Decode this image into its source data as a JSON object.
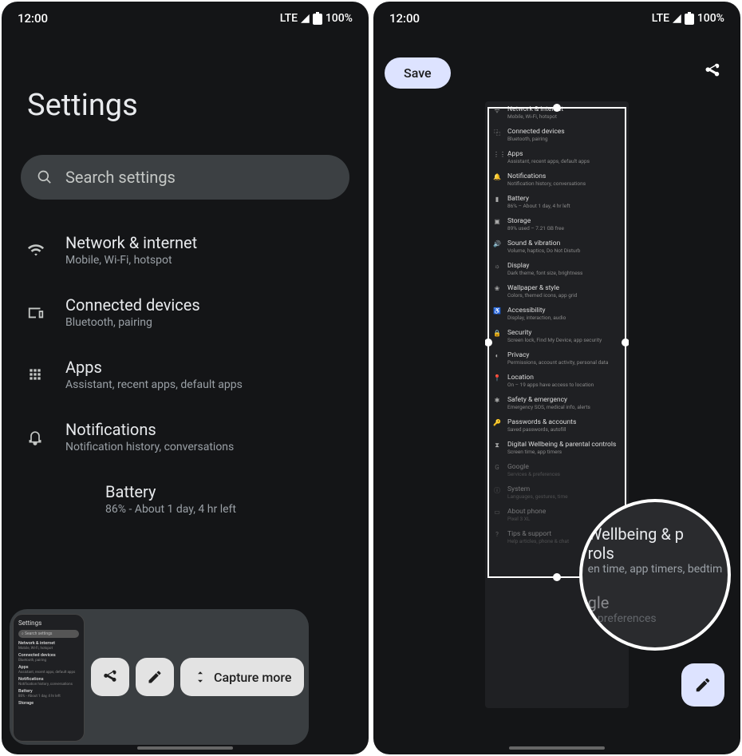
{
  "status": {
    "time": "12:00",
    "lte": "LTE",
    "battery": "100%"
  },
  "left": {
    "title": "Settings",
    "search_placeholder": "Search settings",
    "items": [
      {
        "icon": "wifi",
        "title": "Network & internet",
        "sub": "Mobile, Wi-Fi, hotspot"
      },
      {
        "icon": "devices",
        "title": "Connected devices",
        "sub": "Bluetooth, pairing"
      },
      {
        "icon": "apps",
        "title": "Apps",
        "sub": "Assistant, recent apps, default apps"
      },
      {
        "icon": "bell",
        "title": "Notifications",
        "sub": "Notification history, conversations"
      },
      {
        "icon": "battery",
        "title": "Battery",
        "sub": "86% - About 1 day, 4 hr left"
      }
    ],
    "toast": {
      "share": "Share",
      "edit": "Edit",
      "capture": "Capture more"
    }
  },
  "right": {
    "save": "Save",
    "mini": [
      {
        "icon": "wifi",
        "t": "Network & internet",
        "s": "Mobile, Wi-Fi, hotspot"
      },
      {
        "icon": "dev",
        "t": "Connected devices",
        "s": "Bluetooth, pairing"
      },
      {
        "icon": "apps",
        "t": "Apps",
        "s": "Assistant, recent apps, default apps"
      },
      {
        "icon": "bell",
        "t": "Notifications",
        "s": "Notification history, conversations"
      },
      {
        "icon": "batt",
        "t": "Battery",
        "s": "86% – About 1 day, 4 hr left"
      },
      {
        "icon": "stor",
        "t": "Storage",
        "s": "89% used – 7.21 GB free"
      },
      {
        "icon": "snd",
        "t": "Sound & vibration",
        "s": "Volume, haptics, Do Not Disturb"
      },
      {
        "icon": "disp",
        "t": "Display",
        "s": "Dark theme, font size, brightness"
      },
      {
        "icon": "wall",
        "t": "Wallpaper & style",
        "s": "Colors, themed icons, app grid"
      },
      {
        "icon": "a11y",
        "t": "Accessibility",
        "s": "Display, interaction, audio"
      },
      {
        "icon": "sec",
        "t": "Security",
        "s": "Screen lock, Find My Device, app security"
      },
      {
        "icon": "priv",
        "t": "Privacy",
        "s": "Permissions, account activity, personal data"
      },
      {
        "icon": "loc",
        "t": "Location",
        "s": "On – 19 apps have access to location"
      },
      {
        "icon": "safe",
        "t": "Safety & emergency",
        "s": "Emergency SOS, medical info, alerts"
      },
      {
        "icon": "pw",
        "t": "Passwords & accounts",
        "s": "Saved passwords, autofill"
      },
      {
        "icon": "dw",
        "t": "Digital Wellbeing & parental controls",
        "s": "Screen time, app timers"
      },
      {
        "icon": "g",
        "t": "Google",
        "s": "Services & preferences",
        "fade": true
      },
      {
        "icon": "sys",
        "t": "System",
        "s": "Languages, gestures, time",
        "fade": true
      },
      {
        "icon": "abt",
        "t": "About phone",
        "s": "Pixel 3 XL",
        "fade": true
      },
      {
        "icon": "tip",
        "t": "Tips & support",
        "s": "Help articles, phone & chat",
        "fade": true
      }
    ],
    "mag": {
      "t1": "Wellbeing & p",
      "s1a": "rols",
      "s1b": "en time, app timers, bedtim",
      "t2": "gle",
      "s2": "& preferences"
    }
  }
}
